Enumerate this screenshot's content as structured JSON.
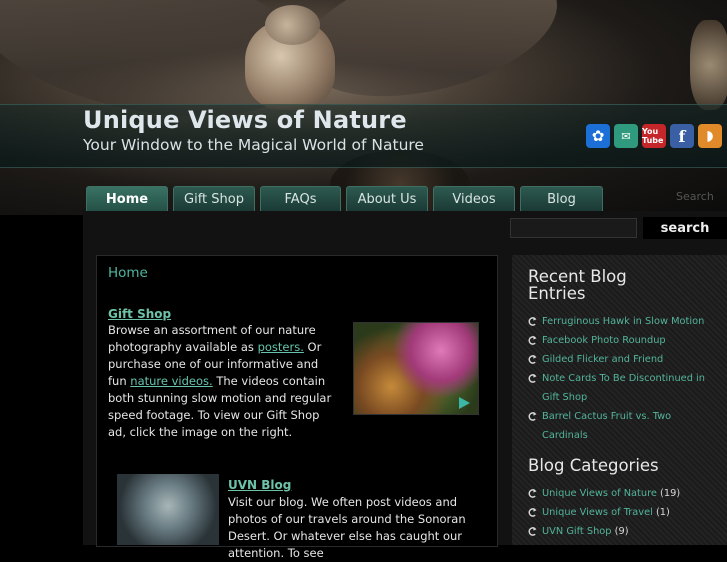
{
  "site": {
    "title": "Unique Views of Nature",
    "tagline": "Your Window to the Magical World of Nature",
    "search_label": "Search",
    "search_button": "search"
  },
  "social": [
    {
      "name": "flickr",
      "glyph": "✿",
      "color": "#1b6fd6"
    },
    {
      "name": "email",
      "glyph": "✉",
      "color": "#2f9a7d"
    },
    {
      "name": "youtube",
      "glyph": "You Tube",
      "color": "#c4262a"
    },
    {
      "name": "facebook",
      "glyph": "f",
      "color": "#3b5fa5"
    },
    {
      "name": "rss",
      "glyph": "◗",
      "color": "#e08a2a"
    }
  ],
  "nav": [
    {
      "label": "Home",
      "active": true
    },
    {
      "label": "Gift Shop",
      "active": false
    },
    {
      "label": "FAQs",
      "active": false
    },
    {
      "label": "About Us",
      "active": false
    },
    {
      "label": "Videos",
      "active": false
    },
    {
      "label": "Blog",
      "active": false
    }
  ],
  "main": {
    "page_title": "Home",
    "giftshop": {
      "heading": "Gift Shop",
      "t1": "Browse an assortment of our nature photography available as ",
      "link1": "posters.",
      "t2": " Or purchase one of our informative and fun ",
      "link2": "nature videos.",
      "t3": " The videos contain both stunning slow motion and regular speed footage. To view our Gift Shop ad, click the image on the right."
    },
    "blog": {
      "heading": "UVN Blog",
      "text": "Visit our blog. We often post videos and photos of our travels around the Sonoran Desert. Or whatever else has caught our attention. To see"
    }
  },
  "sidebar": {
    "recent_title": "Recent Blog Entries",
    "recent": [
      "Ferruginous Hawk in Slow Motion",
      "Facebook Photo Roundup",
      "Gilded Flicker and Friend",
      "Note Cards To Be Discontinued in Gift Shop",
      "Barrel Cactus Fruit vs. Two Cardinals"
    ],
    "categories_title": "Blog Categories",
    "categories": [
      {
        "label": "Unique Views of Nature",
        "count": "(19)"
      },
      {
        "label": "Unique Views of Travel",
        "count": "(1)"
      },
      {
        "label": "UVN Gift Shop",
        "count": "(9)"
      }
    ]
  },
  "colors": {
    "accent": "#4fb7a0",
    "link": "#66c4ae",
    "nav": "#2d5a50"
  }
}
